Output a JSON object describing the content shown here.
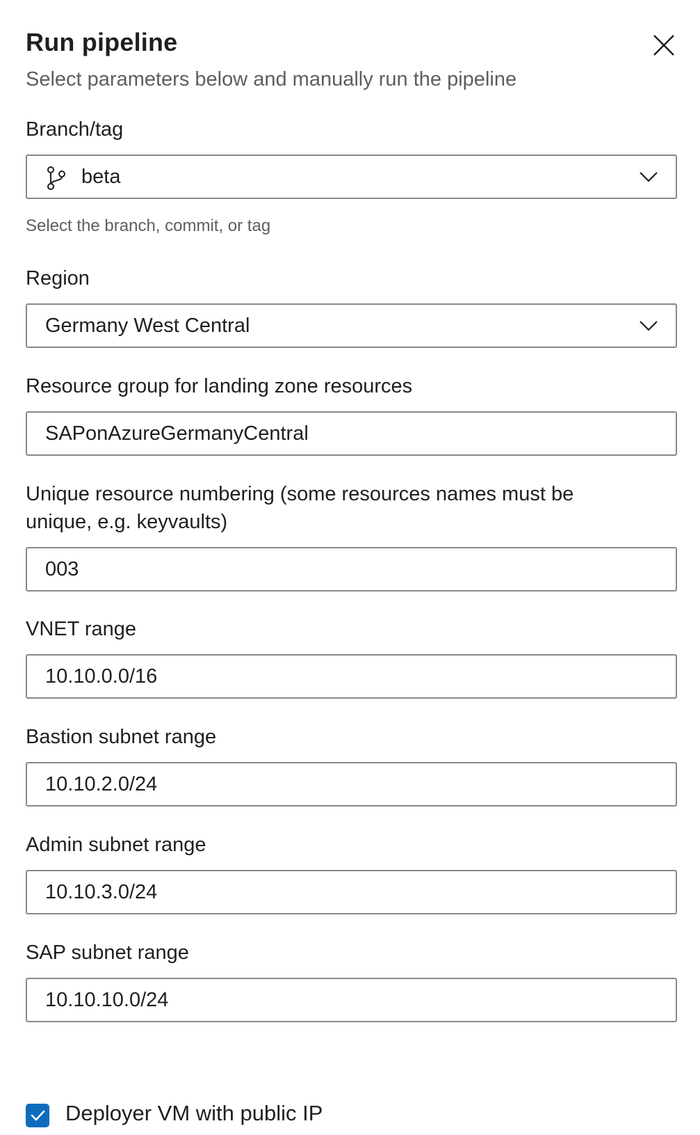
{
  "dialog": {
    "title": "Run pipeline",
    "subtitle": "Select parameters below and manually run the pipeline"
  },
  "branch": {
    "label": "Branch/tag",
    "value": "beta",
    "helper": "Select the branch, commit, or tag"
  },
  "region": {
    "label": "Region",
    "value": "Germany West Central"
  },
  "resource_group": {
    "label": "Resource group for landing zone resources",
    "value": "SAPonAzureGermanyCentral"
  },
  "unique_numbering": {
    "label_line1": "Unique resource numbering (some resources names must be",
    "label_line2": "unique, e.g. keyvaults)",
    "value": "003"
  },
  "vnet_range": {
    "label": "VNET range",
    "value": "10.10.0.0/16"
  },
  "bastion_subnet": {
    "label": "Bastion subnet range",
    "value": "10.10.2.0/24"
  },
  "admin_subnet": {
    "label": "Admin subnet range",
    "value": "10.10.3.0/24"
  },
  "sap_subnet": {
    "label": "SAP subnet range",
    "value": "10.10.10.0/24"
  },
  "deployer_public_ip": {
    "label": "Deployer VM with public IP",
    "checked": true
  },
  "colors": {
    "accent": "#0f6cbd",
    "border": "#8a8886",
    "secondary_text": "#605e5c"
  }
}
